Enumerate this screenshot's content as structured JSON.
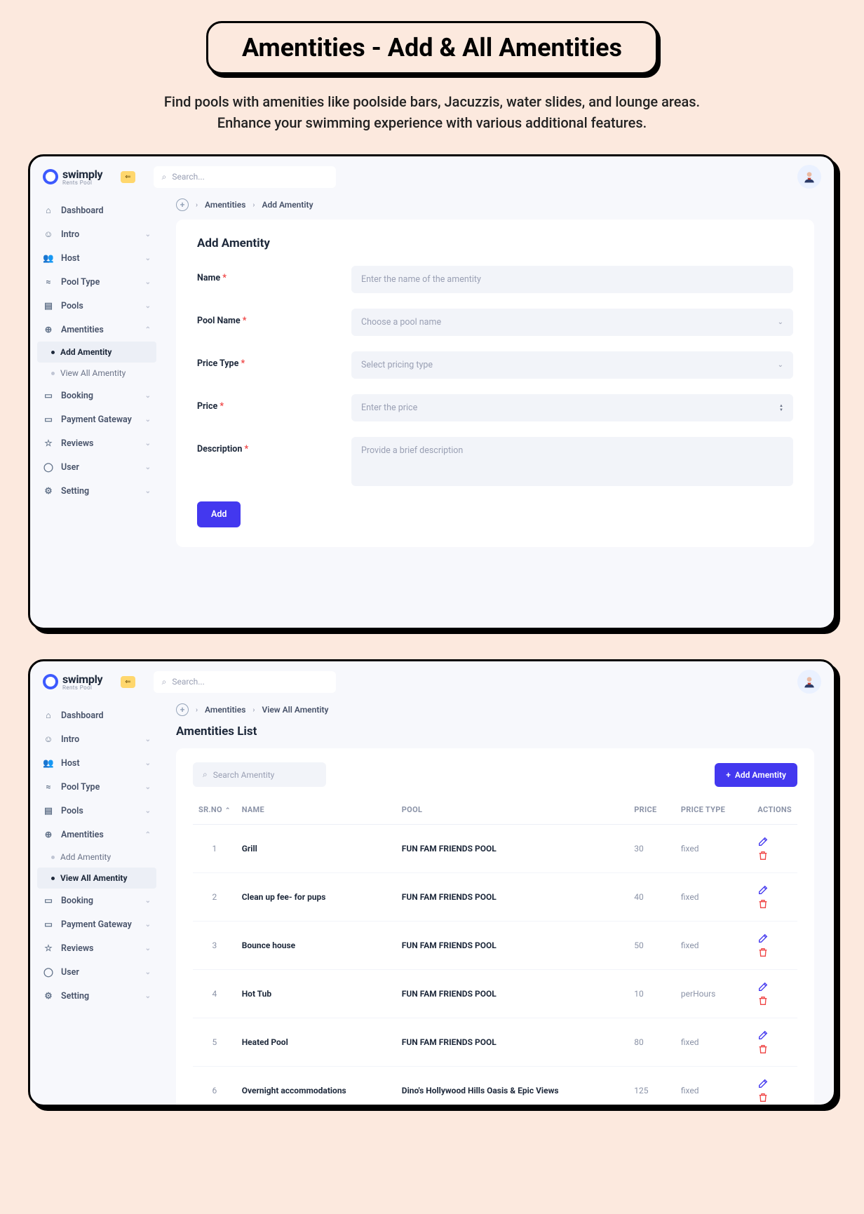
{
  "hero": {
    "title": "Amentities -  Add & All Amentities",
    "desc1": "Find pools with amenities like poolside bars, Jacuzzis, water slides, and lounge areas.",
    "desc2": "Enhance your swimming experience with various additional features."
  },
  "brand": {
    "name": "swimply",
    "sub": "Rents Pool"
  },
  "topSearchPlaceholder": "Search...",
  "sidebar": {
    "items": [
      {
        "label": "Dashboard",
        "expandable": false
      },
      {
        "label": "Intro",
        "expandable": true
      },
      {
        "label": "Host",
        "expandable": true
      },
      {
        "label": "Pool Type",
        "expandable": true
      },
      {
        "label": "Pools",
        "expandable": true
      },
      {
        "label": "Amentities",
        "expandable": true
      },
      {
        "label": "Booking",
        "expandable": true
      },
      {
        "label": "Payment Gateway",
        "expandable": true
      },
      {
        "label": "Reviews",
        "expandable": true
      },
      {
        "label": "User",
        "expandable": true
      },
      {
        "label": "Setting",
        "expandable": true
      }
    ],
    "amenitiesChildren": {
      "add": "Add Amentity",
      "view": "View All Amentity"
    }
  },
  "addPanel": {
    "crumb": {
      "a": "Amentities",
      "b": "Add Amentity"
    },
    "cardTitle": "Add Amentity",
    "labels": {
      "name": "Name",
      "pool": "Pool Name",
      "priceType": "Price Type",
      "price": "Price",
      "desc": "Description"
    },
    "placeholders": {
      "name": "Enter the name of the amentity",
      "pool": "Choose a pool name",
      "priceType": "Select pricing type",
      "price": "Enter the price",
      "desc": "Provide a brief description"
    },
    "submit": "Add"
  },
  "listPanel": {
    "crumb": {
      "a": "Amentities",
      "b": "View All Amentity"
    },
    "title": "Amentities List",
    "searchPlaceholder": "Search Amentity",
    "addBtn": "Add Amentity",
    "columns": {
      "sr": "SR.NO",
      "name": "NAME",
      "pool": "POOL",
      "price": "PRICE",
      "ptype": "PRICE TYPE",
      "actions": "ACTIONS"
    },
    "rows": [
      {
        "idx": "1",
        "name": "Grill",
        "pool": "FUN FAM FRIENDS POOL",
        "price": "30",
        "ptype": "fixed"
      },
      {
        "idx": "2",
        "name": "Clean up fee- for pups",
        "pool": "FUN FAM FRIENDS POOL",
        "price": "40",
        "ptype": "fixed"
      },
      {
        "idx": "3",
        "name": "Bounce house",
        "pool": "FUN FAM FRIENDS POOL",
        "price": "50",
        "ptype": "fixed"
      },
      {
        "idx": "4",
        "name": "Hot Tub",
        "pool": "FUN FAM FRIENDS POOL",
        "price": "10",
        "ptype": "perHours"
      },
      {
        "idx": "5",
        "name": "Heated Pool",
        "pool": "FUN FAM FRIENDS POOL",
        "price": "80",
        "ptype": "fixed"
      },
      {
        "idx": "6",
        "name": "Overnight accommodations",
        "pool": "Dino's Hollywood Hills Oasis & Epic Views",
        "price": "125",
        "ptype": "fixed"
      }
    ]
  }
}
